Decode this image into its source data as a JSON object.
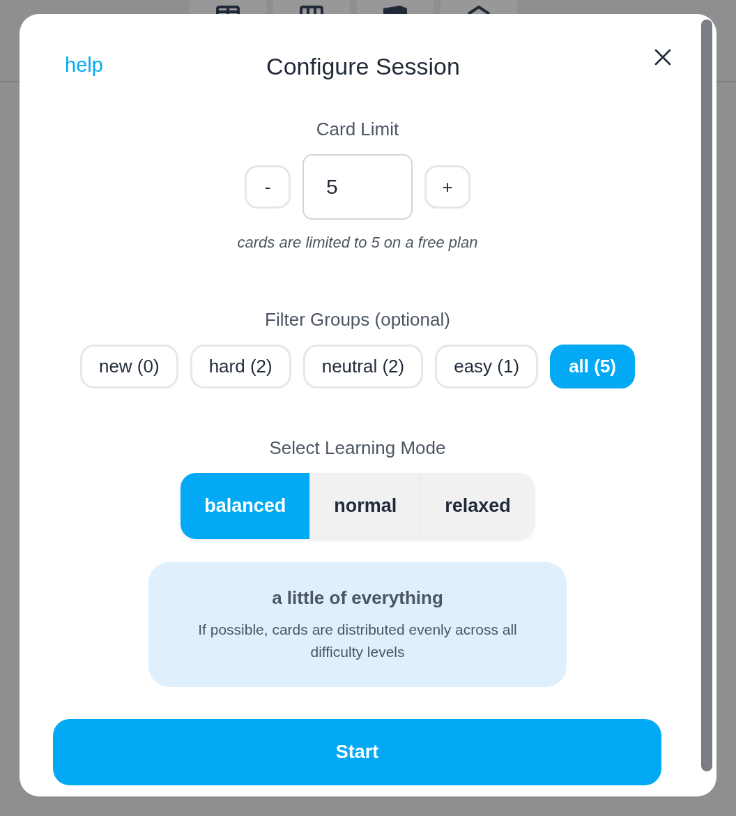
{
  "header": {
    "help_link": "help",
    "title": "Configure Session"
  },
  "card_limit": {
    "label": "Card Limit",
    "decrement": "-",
    "value": "5",
    "increment": "+",
    "note": "cards are limited to 5 on a free plan"
  },
  "filter_groups": {
    "label": "Filter Groups (optional)",
    "options": [
      {
        "label": "new (0)",
        "selected": false
      },
      {
        "label": "hard (2)",
        "selected": false
      },
      {
        "label": "neutral (2)",
        "selected": false
      },
      {
        "label": "easy (1)",
        "selected": false
      },
      {
        "label": "all (5)",
        "selected": true
      }
    ]
  },
  "learning_mode": {
    "label": "Select Learning Mode",
    "modes": [
      {
        "label": "balanced",
        "selected": true
      },
      {
        "label": "normal",
        "selected": false
      },
      {
        "label": "relaxed",
        "selected": false
      }
    ],
    "description": {
      "title": "a little of everything",
      "text": "If possible, cards are distributed evenly across all difficulty levels"
    }
  },
  "start_button": "Start"
}
